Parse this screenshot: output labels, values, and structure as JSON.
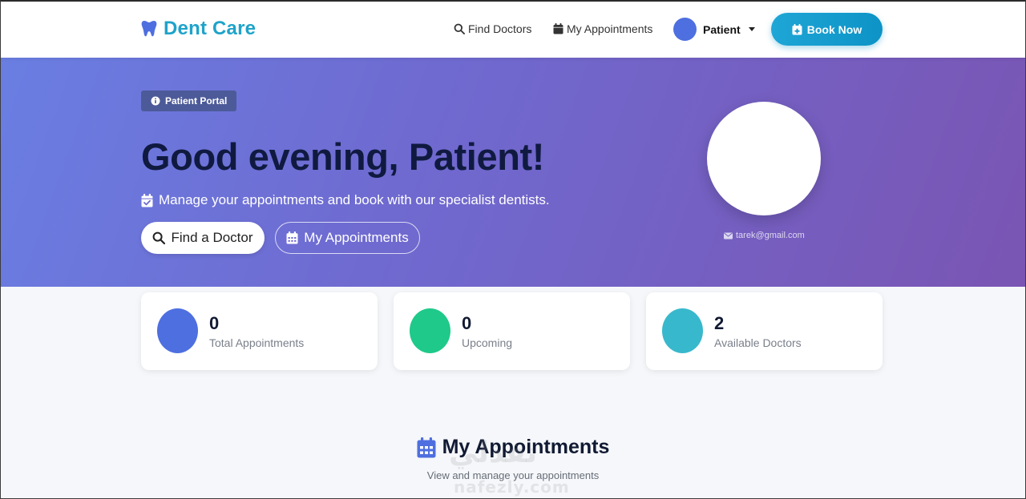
{
  "navbar": {
    "brand_name": "Dent Care",
    "brand_icon": "tooth-icon",
    "find_doctors_label": "Find Doctors",
    "my_appointments_label": "My Appointments",
    "user_name": "Patient",
    "book_now_label": "Book Now"
  },
  "hero": {
    "badge_label": "Patient Portal",
    "greeting": "Good evening, Patient!",
    "subtitle": "Manage your appointments and book with our specialist dentists.",
    "find_doctor_button": "Find a Doctor",
    "my_appointments_button": "My Appointments",
    "email": "tarek@gmail.com"
  },
  "stats": [
    {
      "value": "0",
      "label": "Total Appointments",
      "color": "#4e6fe0"
    },
    {
      "value": "0",
      "label": "Upcoming",
      "color": "#1fc98a"
    },
    {
      "value": "2",
      "label": "Available Doctors",
      "color": "#38b8cc"
    }
  ],
  "section": {
    "title": "My Appointments",
    "subtitle": "View and manage your appointments"
  },
  "watermark": {
    "text": "نفذلي",
    "domain": "nafezly.com"
  },
  "colors": {
    "brand": "#1fa3c9",
    "accent": "#4e6fe0",
    "hero_start": "#6a7ee2",
    "hero_end": "#7a55b3"
  }
}
